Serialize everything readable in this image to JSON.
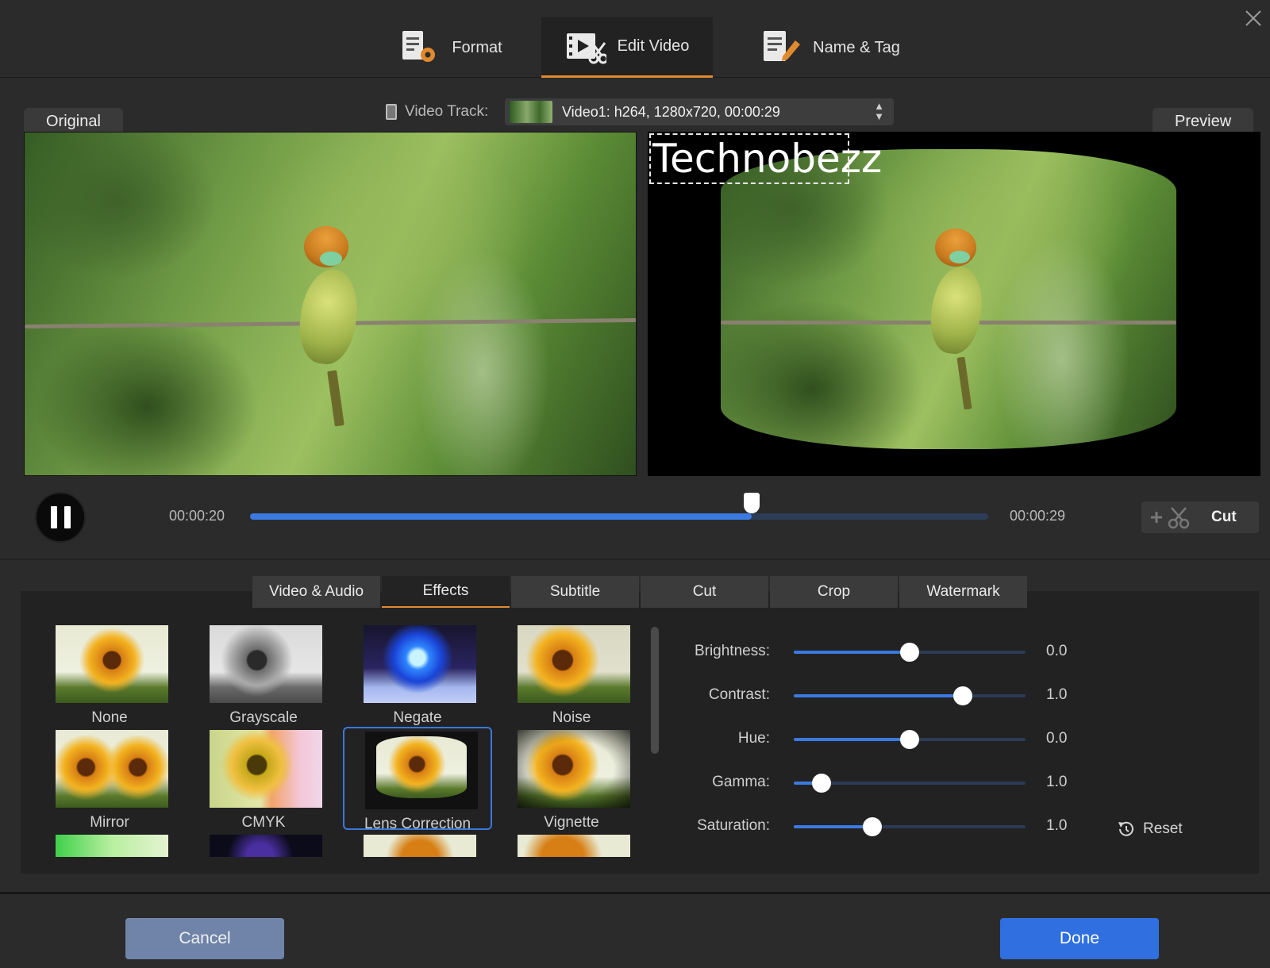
{
  "top_tabs": [
    {
      "label": "Format",
      "icon": "format-settings-icon",
      "active": false
    },
    {
      "label": "Edit Video",
      "icon": "edit-video-icon",
      "active": true
    },
    {
      "label": "Name & Tag",
      "icon": "name-tag-icon",
      "active": false
    }
  ],
  "video": {
    "original_label": "Original",
    "preview_label": "Preview",
    "track_label": "Video Track:",
    "track_value": "Video1: h264, 1280x720, 00:00:29",
    "watermark_text": "Technobezz"
  },
  "playback": {
    "current_time": "00:00:20",
    "total_time": "00:00:29",
    "progress": 0.68,
    "cut_label": "Cut"
  },
  "edit_tabs": [
    {
      "label": "Video & Audio",
      "active": false
    },
    {
      "label": "Effects",
      "active": true
    },
    {
      "label": "Subtitle",
      "active": false
    },
    {
      "label": "Cut",
      "active": false
    },
    {
      "label": "Crop",
      "active": false
    },
    {
      "label": "Watermark",
      "active": false
    }
  ],
  "effects": [
    {
      "label": "None"
    },
    {
      "label": "Grayscale"
    },
    {
      "label": "Negate"
    },
    {
      "label": "Noise"
    },
    {
      "label": "Mirror"
    },
    {
      "label": "CMYK"
    },
    {
      "label": "Lens Correction",
      "selected": true
    },
    {
      "label": "Vignette"
    }
  ],
  "adjustments": [
    {
      "label": "Brightness:",
      "value": "0.0",
      "level": 0.5
    },
    {
      "label": "Contrast:",
      "value": "1.0",
      "level": 0.73
    },
    {
      "label": "Hue:",
      "value": "0.0",
      "level": 0.5
    },
    {
      "label": "Gamma:",
      "value": "1.0",
      "level": 0.12
    },
    {
      "label": "Saturation:",
      "value": "1.0",
      "level": 0.34
    }
  ],
  "reset_label": "Reset",
  "buttons": {
    "cancel": "Cancel",
    "done": "Done"
  },
  "colors": {
    "accent_orange": "#e08a2e",
    "accent_blue": "#3b7ae0",
    "done_blue": "#2f6fe0",
    "cancel_slate": "#6f84a8"
  }
}
